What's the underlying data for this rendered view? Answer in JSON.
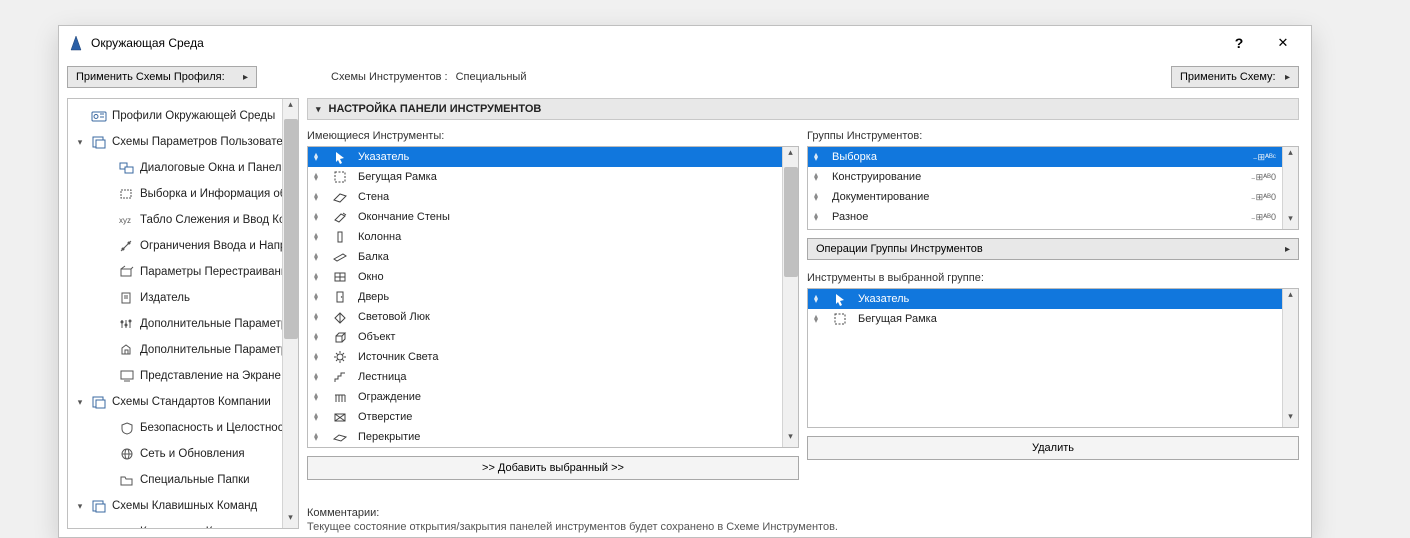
{
  "window": {
    "title": "Окружающая Среда"
  },
  "top": {
    "apply_profile_btn": "Применить Схемы Профиля:",
    "schemas_label": "Схемы Инструментов :",
    "schema_value": "Специальный",
    "apply_scheme_btn": "Применить Схему:"
  },
  "sidebar": {
    "items": [
      {
        "indent": 0,
        "caret": "",
        "icon": "profiles",
        "label": "Профили Окружающей Среды"
      },
      {
        "indent": 0,
        "caret": "▾",
        "icon": "user-schemes",
        "label": "Схемы Параметров Пользователя"
      },
      {
        "indent": 2,
        "caret": "",
        "icon": "dialogs",
        "label": "Диалоговые Окна и Панели"
      },
      {
        "indent": 2,
        "caret": "",
        "icon": "selection",
        "label": "Выборка и Информация об Эле"
      },
      {
        "indent": 2,
        "caret": "",
        "icon": "tracker",
        "label": "Табло Слежения и Ввод Коорди"
      },
      {
        "indent": 2,
        "caret": "",
        "icon": "constraints",
        "label": "Ограничения Ввода и Направл"
      },
      {
        "indent": 2,
        "caret": "",
        "icon": "rebuild",
        "label": "Параметры Перестраивания Мо"
      },
      {
        "indent": 2,
        "caret": "",
        "icon": "publisher",
        "label": "Издатель"
      },
      {
        "indent": 2,
        "caret": "",
        "icon": "more",
        "label": "Дополнительные Параметры"
      },
      {
        "indent": 2,
        "caret": "",
        "icon": "more-o",
        "label": "Дополнительные Параметры О"
      },
      {
        "indent": 2,
        "caret": "",
        "icon": "screen",
        "label": "Представление на Экране"
      },
      {
        "indent": 0,
        "caret": "▾",
        "icon": "company",
        "label": "Схемы Стандартов Компании"
      },
      {
        "indent": 2,
        "caret": "",
        "icon": "security",
        "label": "Безопасность и Целостность да"
      },
      {
        "indent": 2,
        "caret": "",
        "icon": "network",
        "label": "Сеть и Обновления"
      },
      {
        "indent": 2,
        "caret": "",
        "icon": "folders",
        "label": "Специальные Папки"
      },
      {
        "indent": 0,
        "caret": "▾",
        "icon": "keyboard",
        "label": "Схемы Клавишных Команд"
      },
      {
        "indent": 2,
        "caret": "",
        "icon": "keys",
        "label": "Клавишные Команды"
      }
    ]
  },
  "section_header": "НАСТРОЙКА ПАНЕЛИ ИНСТРУМЕНТОВ",
  "left": {
    "label": "Имеющиеся Инструменты:",
    "tools": [
      {
        "icon": "pointer",
        "label": "Указатель",
        "selected": true
      },
      {
        "icon": "marquee",
        "label": "Бегущая Рамка"
      },
      {
        "icon": "wall",
        "label": "Стена"
      },
      {
        "icon": "wallend",
        "label": "Окончание Стены"
      },
      {
        "icon": "column",
        "label": "Колонна"
      },
      {
        "icon": "beam",
        "label": "Балка"
      },
      {
        "icon": "window",
        "label": "Окно"
      },
      {
        "icon": "door",
        "label": "Дверь"
      },
      {
        "icon": "skylight",
        "label": "Световой Люк"
      },
      {
        "icon": "object",
        "label": "Объект"
      },
      {
        "icon": "light",
        "label": "Источник Света"
      },
      {
        "icon": "stair",
        "label": "Лестница"
      },
      {
        "icon": "railing",
        "label": "Ограждение"
      },
      {
        "icon": "opening",
        "label": "Отверстие"
      },
      {
        "icon": "slab",
        "label": "Перекрытие"
      }
    ],
    "add_btn": ">> Добавить выбранный >>"
  },
  "right": {
    "groups_label": "Группы Инструментов:",
    "groups": [
      {
        "label": "Выборка",
        "tag": "₋⊞ᴬᴮᶜ",
        "selected": true
      },
      {
        "label": "Конструирование",
        "tag": "₋⊞ᴬᴮ0"
      },
      {
        "label": "Документирование",
        "tag": "₋⊞ᴬᴮ0"
      },
      {
        "label": "Разное",
        "tag": "₋⊞ᴬᴮ0"
      }
    ],
    "ops_btn": "Операции Группы Инструментов",
    "group_tools_label": "Инструменты в выбранной группе:",
    "group_tools": [
      {
        "icon": "pointer",
        "label": "Указатель",
        "selected": true
      },
      {
        "icon": "marquee",
        "label": "Бегущая Рамка"
      }
    ],
    "remove_btn": "Удалить"
  },
  "comments": {
    "label": "Комментарии:",
    "text": "Текущее состояние открытия/закрытия панелей инструментов будет сохранено в Схеме Инструментов."
  }
}
